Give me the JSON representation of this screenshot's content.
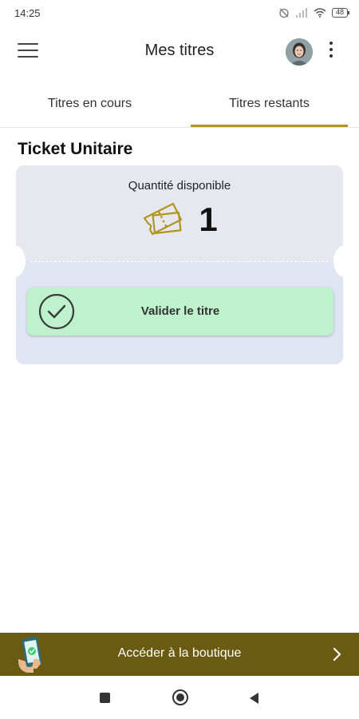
{
  "status_bar": {
    "time": "14:25",
    "battery": "48"
  },
  "app_bar": {
    "title": "Mes titres"
  },
  "tabs": [
    {
      "label": "Titres en cours",
      "active": false
    },
    {
      "label": "Titres restants",
      "active": true
    }
  ],
  "section": {
    "title": "Ticket Unitaire"
  },
  "ticket": {
    "quantity_label": "Quantité disponible",
    "quantity_value": "1",
    "validate_label": "Valider le titre"
  },
  "shop_banner": {
    "label": "Accéder à la boutique"
  },
  "colors": {
    "accent": "#b2951d",
    "banner": "#6a5a12",
    "validate_bg": "#bdf2cc",
    "card_top": "#e5e8ef",
    "card_bottom": "#dfe5f1"
  },
  "icons": {
    "menu": "menu-icon",
    "avatar": "avatar",
    "more": "more-vertical-icon",
    "ticket": "ticket-icon",
    "check": "check-circle-icon",
    "phone": "phone-icon",
    "chevron": "chevron-right-icon"
  }
}
